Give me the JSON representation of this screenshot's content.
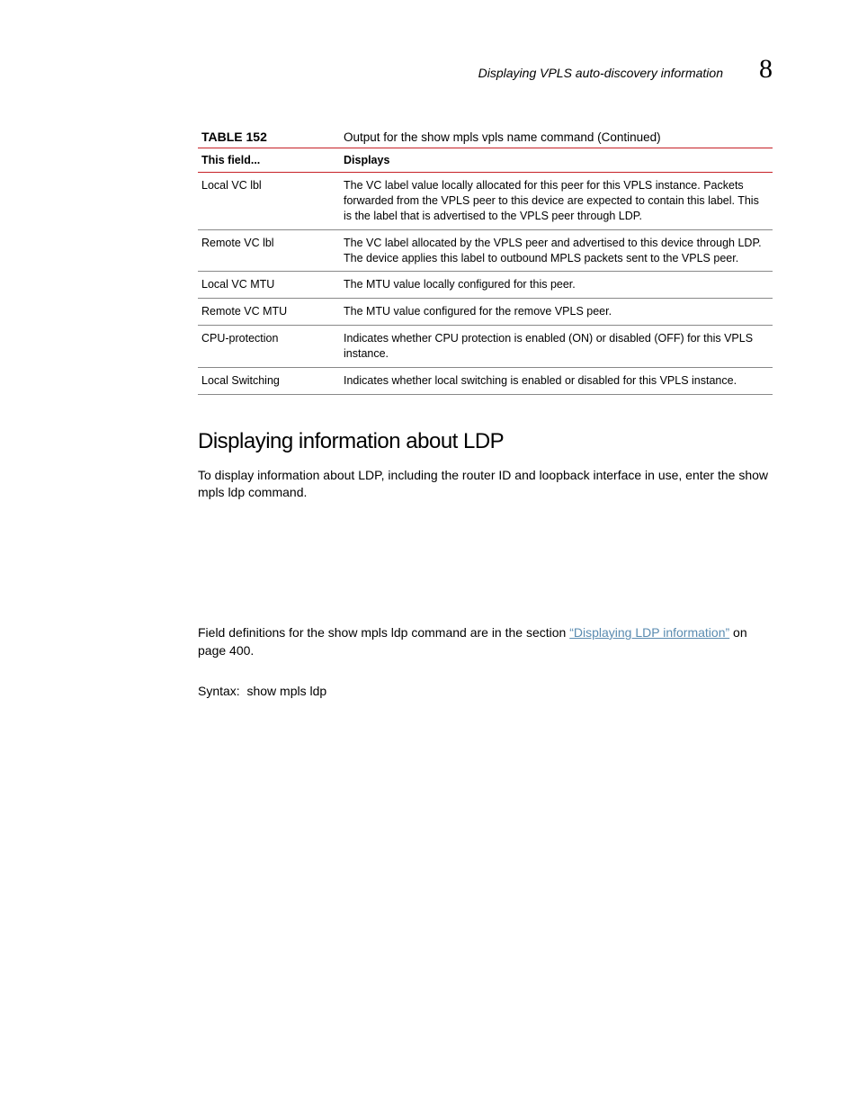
{
  "header": {
    "running_title": "Displaying VPLS auto-discovery information",
    "chapter_number": "8"
  },
  "table": {
    "label": "TABLE 152",
    "title": "Output for the show mpls vpls name command (Continued)",
    "col1_header": "This field...",
    "col2_header": "Displays",
    "rows": [
      {
        "field": "Local VC lbl",
        "desc": "The VC label value locally allocated for this peer for this VPLS instance. Packets forwarded from the VPLS peer to this device are expected to contain this label. This is the label that is advertised to the VPLS peer through LDP."
      },
      {
        "field": "Remote VC lbl",
        "desc": "The VC label allocated by the VPLS peer and advertised to this device through LDP. The device applies this label to outbound MPLS packets sent to the VPLS peer."
      },
      {
        "field": "Local VC MTU",
        "desc": "The MTU value locally configured for this peer."
      },
      {
        "field": "Remote VC MTU",
        "desc": "The MTU value configured for the remove VPLS peer."
      },
      {
        "field": "CPU-protection",
        "desc": "Indicates whether CPU protection is enabled (ON) or disabled (OFF) for this VPLS instance."
      },
      {
        "field": "Local Switching",
        "desc": "Indicates whether local switching is enabled or disabled for this VPLS instance."
      }
    ]
  },
  "section": {
    "heading": "Displaying information about LDP",
    "para1": "To display information about LDP, including the router ID and loopback interface in use, enter the show mpls ldp command.",
    "para2_pre": "Field definitions for the show mpls ldp command are in the section ",
    "para2_link": "“Displaying LDP information”",
    "para2_post": " on page 400.",
    "syntax": "Syntax:  show mpls ldp"
  }
}
